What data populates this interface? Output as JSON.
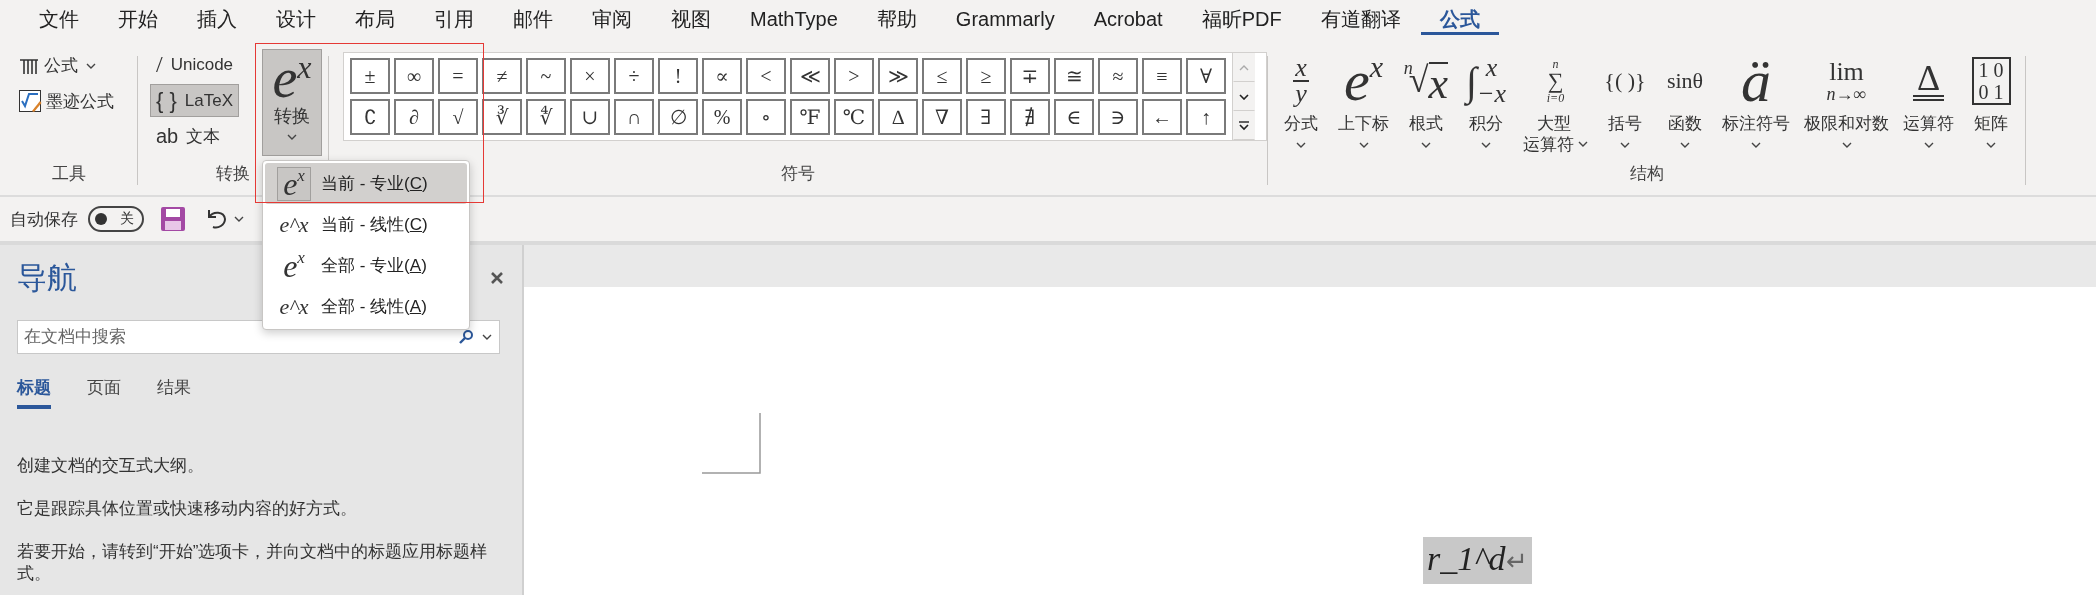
{
  "menu_tabs": [
    {
      "label": "文件",
      "selected": false
    },
    {
      "label": "开始",
      "selected": false
    },
    {
      "label": "插入",
      "selected": false
    },
    {
      "label": "设计",
      "selected": false
    },
    {
      "label": "布局",
      "selected": false
    },
    {
      "label": "引用",
      "selected": false
    },
    {
      "label": "邮件",
      "selected": false
    },
    {
      "label": "审阅",
      "selected": false
    },
    {
      "label": "视图",
      "selected": false
    },
    {
      "label": "MathType",
      "selected": false
    },
    {
      "label": "帮助",
      "selected": false
    },
    {
      "label": "Grammarly",
      "selected": false
    },
    {
      "label": "Acrobat",
      "selected": false
    },
    {
      "label": "福昕PDF",
      "selected": false
    },
    {
      "label": "有道翻译",
      "selected": false
    },
    {
      "label": "公式",
      "selected": true
    }
  ],
  "tools": {
    "label": "工具",
    "equation_button": {
      "label": "公式"
    },
    "ink_button": {
      "label": "墨迹公式"
    }
  },
  "conversions": {
    "label": "转换",
    "modes": [
      {
        "kind": "unicode",
        "icon_text": "/",
        "label": "Unicode",
        "selected": false
      },
      {
        "kind": "latex",
        "icon_text": "{ }",
        "label": "LaTeX",
        "selected": true
      },
      {
        "kind": "text",
        "icon_text": "ab",
        "label": "文本",
        "selected": false
      }
    ],
    "convert_button": {
      "base": "e",
      "exponent": "x",
      "label": "转换",
      "pressed": true
    }
  },
  "symbols": {
    "label": "符号",
    "rows": [
      [
        "±",
        "∞",
        "=",
        "≠",
        "~",
        "×",
        "÷",
        "!",
        "∝",
        "<",
        "≪",
        ">",
        "≫",
        "≤",
        "≥",
        "∓",
        "≅",
        "≈",
        "≡",
        "∀"
      ],
      [
        "∁",
        "∂",
        "√",
        "∛",
        "∜",
        "∪",
        "∩",
        "∅",
        "%",
        "∘",
        "℉",
        "℃",
        "∆",
        "∇",
        "∃",
        "∄",
        "∈",
        "∋",
        "←",
        "↑"
      ]
    ]
  },
  "structures": {
    "label": "结构",
    "items": [
      {
        "kind": "fraction",
        "label": "分式",
        "parts": [
          "x",
          "y"
        ]
      },
      {
        "kind": "script",
        "label": "上下标",
        "parts": [
          "e",
          "x"
        ]
      },
      {
        "kind": "radical",
        "label": "根式",
        "parts": [
          "n",
          "√",
          "x"
        ]
      },
      {
        "kind": "integral",
        "label": "积分",
        "parts": [
          "∫",
          "x",
          "−x"
        ]
      },
      {
        "kind": "largeop",
        "label": "大型运算符",
        "parts": [
          "n",
          "∑",
          "i=0"
        ]
      },
      {
        "kind": "plain",
        "label": "括号",
        "parts": [
          "{( )}"
        ]
      },
      {
        "kind": "plain",
        "label": "函数",
        "parts": [
          "sinθ"
        ]
      },
      {
        "kind": "accent",
        "label": "标注符号",
        "parts": [
          "ä"
        ]
      },
      {
        "kind": "limit",
        "label": "极限和对数",
        "parts": [
          "lim",
          "n→∞"
        ]
      },
      {
        "kind": "operator",
        "label": "运算符",
        "parts": [
          "Δ"
        ]
      },
      {
        "kind": "matrix",
        "label": "矩阵",
        "parts": [
          "1 0",
          "0 1"
        ]
      }
    ]
  },
  "convert_menu": {
    "items": [
      {
        "kind": "professional",
        "icon": [
          "e",
          "x"
        ],
        "before": "当前 - 专业(",
        "key": "C",
        "after": ")",
        "selected": true
      },
      {
        "kind": "linear",
        "icon": [
          "e^x"
        ],
        "before": "当前 - 线性(",
        "key": "C",
        "after": ")",
        "selected": false
      },
      {
        "kind": "professional",
        "icon": [
          "e",
          "x"
        ],
        "before": "全部 - 专业(",
        "key": "A",
        "after": ")",
        "selected": false
      },
      {
        "kind": "linear",
        "icon": [
          "e^x"
        ],
        "before": "全部 - 线性(",
        "key": "A",
        "after": ")",
        "selected": false
      }
    ]
  },
  "quick_access": {
    "autosave_label": "自动保存",
    "autosave": {
      "on": false,
      "label": "关"
    }
  },
  "navigation": {
    "title": "导航",
    "search": {
      "placeholder": "在文档中搜索"
    },
    "tabs": [
      {
        "label": "标题",
        "selected": true
      },
      {
        "label": "页面",
        "selected": false
      },
      {
        "label": "结果",
        "selected": false
      }
    ],
    "paragraphs": [
      "创建文档的交互式大纲。",
      "它是跟踪具体位置或快速移动内容的好方式。",
      "若要开始，请转到“开始”选项卡，并向文档中的标题应用标题样式。"
    ]
  },
  "document": {
    "equation": "r_1^d",
    "paragraph_mark": "↵"
  }
}
